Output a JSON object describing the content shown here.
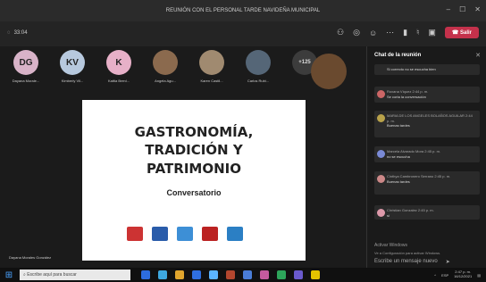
{
  "window": {
    "title": "REUNIÓN CON EL PERSONAL TARDE NAVIDEÑA MUNICIPAL",
    "min": "–",
    "max": "☐",
    "close": "✕"
  },
  "toolbar": {
    "timer": "33:04",
    "leave_label": "Salir",
    "icons": [
      "people-icon",
      "chat-icon",
      "reactions-icon",
      "more-icon",
      "camera-icon",
      "mic-icon",
      "share-icon"
    ]
  },
  "participants": [
    {
      "initials": "DG",
      "name": "Dayana Morale...",
      "color": "#d8b3c8"
    },
    {
      "initials": "KV",
      "name": "Kimberly Vil...",
      "color": "#b7c9de"
    },
    {
      "initials": "K",
      "name": "Kattia Brenl...",
      "color": "#e7b0c8"
    },
    {
      "initials": "",
      "name": "Angela Agu...",
      "color": "#8b6a4e"
    },
    {
      "initials": "",
      "name": "Karen Castil...",
      "color": "#a08a70"
    },
    {
      "initials": "",
      "name": "Carlos Rubi...",
      "color": "#556677"
    },
    {
      "initials": "+125",
      "name": "",
      "color": "#3c3c3c"
    }
  ],
  "slide": {
    "title_line1": "GASTRONOMÍA,",
    "title_line2": "TRADICIÓN Y",
    "title_line3": "PATRIMONIO",
    "subtitle": "Conversatorio"
  },
  "presenter": "Dayana Morales González",
  "chat": {
    "header": "Chat de la reunión",
    "messages": [
      {
        "name": "",
        "time": "",
        "text": "Si correcto no se escucha bien",
        "color": "#555"
      },
      {
        "name": "Roxana Víquez",
        "time": "2:44 p. m.",
        "text": "Se corta la conversación",
        "color": "#c66"
      },
      {
        "name": "MARIA DE LOS ANGELES BOLAÑOS AGUILAR",
        "time": "2:44 p. m.",
        "text": "Buenas tardes",
        "color": "#b9a24a"
      },
      {
        "name": "Marcela Alvarado Mora",
        "time": "2:45 p. m.",
        "text": "no se escucha",
        "color": "#7a8ad6"
      },
      {
        "name": "Cinthya Cambronero Serrano",
        "time": "2:45 p. m.",
        "text": "Buenas tardes",
        "color": "#c88"
      },
      {
        "name": "Christian Gonzalez",
        "time": "2:45 p. m.",
        "text": "si",
        "color": "#d9a"
      }
    ],
    "compose_placeholder": "Escribe un mensaje nuevo",
    "activation_title": "Activar Windows",
    "activation_text": "Ve a Configuración para activar Windows."
  },
  "taskbar": {
    "search_placeholder": "Escribe aquí para buscar",
    "lang": "ESP",
    "time": "2:47 p. m.",
    "date": "16/12/2021",
    "apps": [
      "#2d6cdf",
      "#3ea8e0",
      "#e0a52d",
      "#2f6fdf",
      "#5bb4ff",
      "#b2462e",
      "#4a7dd8",
      "#c55a9e",
      "#2da55a",
      "#6a5acd",
      "#e5c300"
    ]
  }
}
